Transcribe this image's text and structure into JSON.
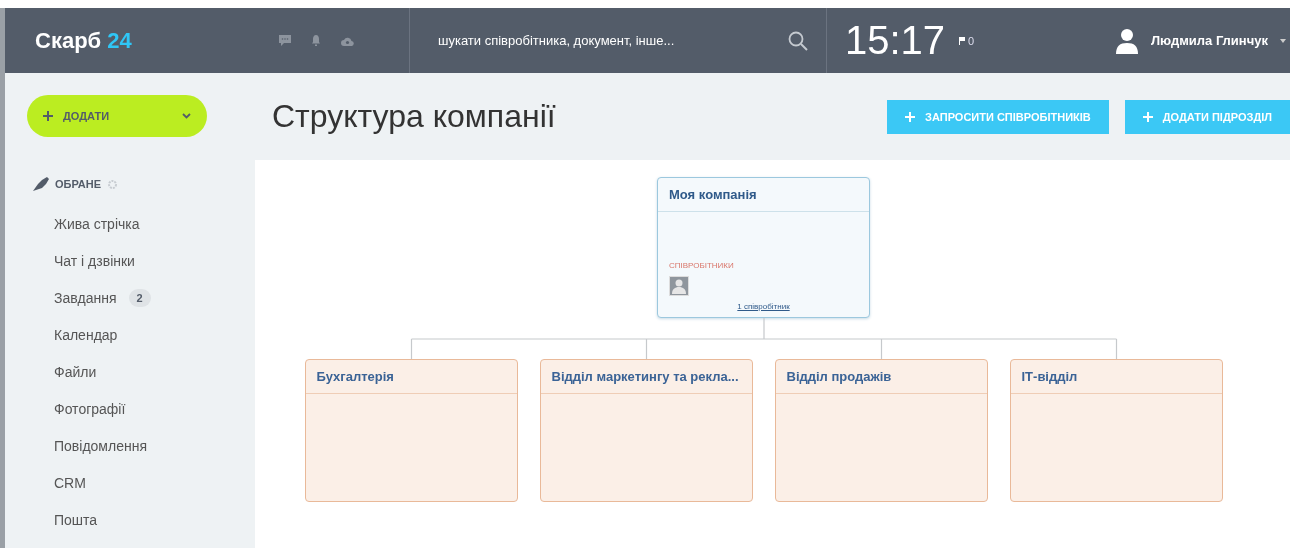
{
  "header": {
    "logo": {
      "name": "Скарб",
      "number": "24"
    },
    "search": {
      "placeholder": "шукати співробітника, документ, інше..."
    },
    "clock": "15:17",
    "flag_count": "0",
    "user": {
      "name": "Людмила Глинчук"
    }
  },
  "add_button": {
    "label": "ДОДАТИ"
  },
  "sidebar": {
    "section": "ОБРАНЕ",
    "items": [
      {
        "label": "Жива стрічка"
      },
      {
        "label": "Чат і дзвінки"
      },
      {
        "label": "Завдання",
        "badge": "2"
      },
      {
        "label": "Календар"
      },
      {
        "label": "Файли"
      },
      {
        "label": "Фотографії"
      },
      {
        "label": "Повідомлення"
      },
      {
        "label": "CRM"
      },
      {
        "label": "Пошта"
      }
    ]
  },
  "page": {
    "title": "Структура компанії",
    "buttons": [
      {
        "label": "ЗАПРОСИТИ СПІВРОБІТНИКІВ"
      },
      {
        "label": "ДОДАТИ ПІДРОЗДІЛ"
      }
    ]
  },
  "org_chart": {
    "root": {
      "title": "Моя компанія",
      "employees_label": "СПІВРОБІТНИКИ",
      "employees_link": "1 співробітник"
    },
    "departments": [
      {
        "title": "Бухгалтерія"
      },
      {
        "title": "Відділ маркетингу та рекла..."
      },
      {
        "title": "Відділ продажів"
      },
      {
        "title": "ІТ-відділ"
      }
    ]
  }
}
